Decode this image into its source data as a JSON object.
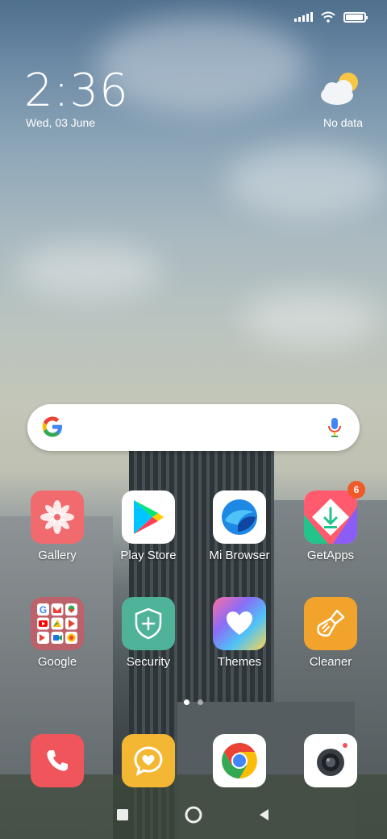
{
  "status": {
    "signal": "signal-icon",
    "wifi": "wifi-icon",
    "battery_level": 0.95
  },
  "clock": {
    "time": "2:36",
    "date": "Wed, 03 June"
  },
  "weather": {
    "icon": "partly-cloudy-icon",
    "label": "No data"
  },
  "search": {
    "logo": "google-g-icon",
    "mic": "mic-icon"
  },
  "apps_row1": [
    {
      "label": "Gallery",
      "icon": "gallery-icon",
      "color": "#f06a6e"
    },
    {
      "label": "Play Store",
      "icon": "play-store-icon",
      "color": "#ffffff"
    },
    {
      "label": "Mi Browser",
      "icon": "mi-browser-icon",
      "color": "#ffffff"
    },
    {
      "label": "GetApps",
      "icon": "getapps-icon",
      "color": "#ffffff",
      "badge": "6"
    }
  ],
  "apps_row2": [
    {
      "label": "Google",
      "icon": "google-folder-icon",
      "color": "#c45a66"
    },
    {
      "label": "Security",
      "icon": "security-icon",
      "color": "#4fb39a"
    },
    {
      "label": "Themes",
      "icon": "themes-icon",
      "color": "#9b6cf0"
    },
    {
      "label": "Cleaner",
      "icon": "cleaner-icon",
      "color": "#f2a32b"
    }
  ],
  "dock": [
    {
      "icon": "phone-icon",
      "color": "#f0555b"
    },
    {
      "icon": "messages-icon",
      "color": "#f4b733"
    },
    {
      "icon": "chrome-icon",
      "color": "#ffffff"
    },
    {
      "icon": "camera-icon",
      "color": "#ffffff"
    }
  ],
  "pages": {
    "count": 2,
    "active": 1
  },
  "navigation": [
    "recents-button",
    "home-button",
    "back-button"
  ]
}
